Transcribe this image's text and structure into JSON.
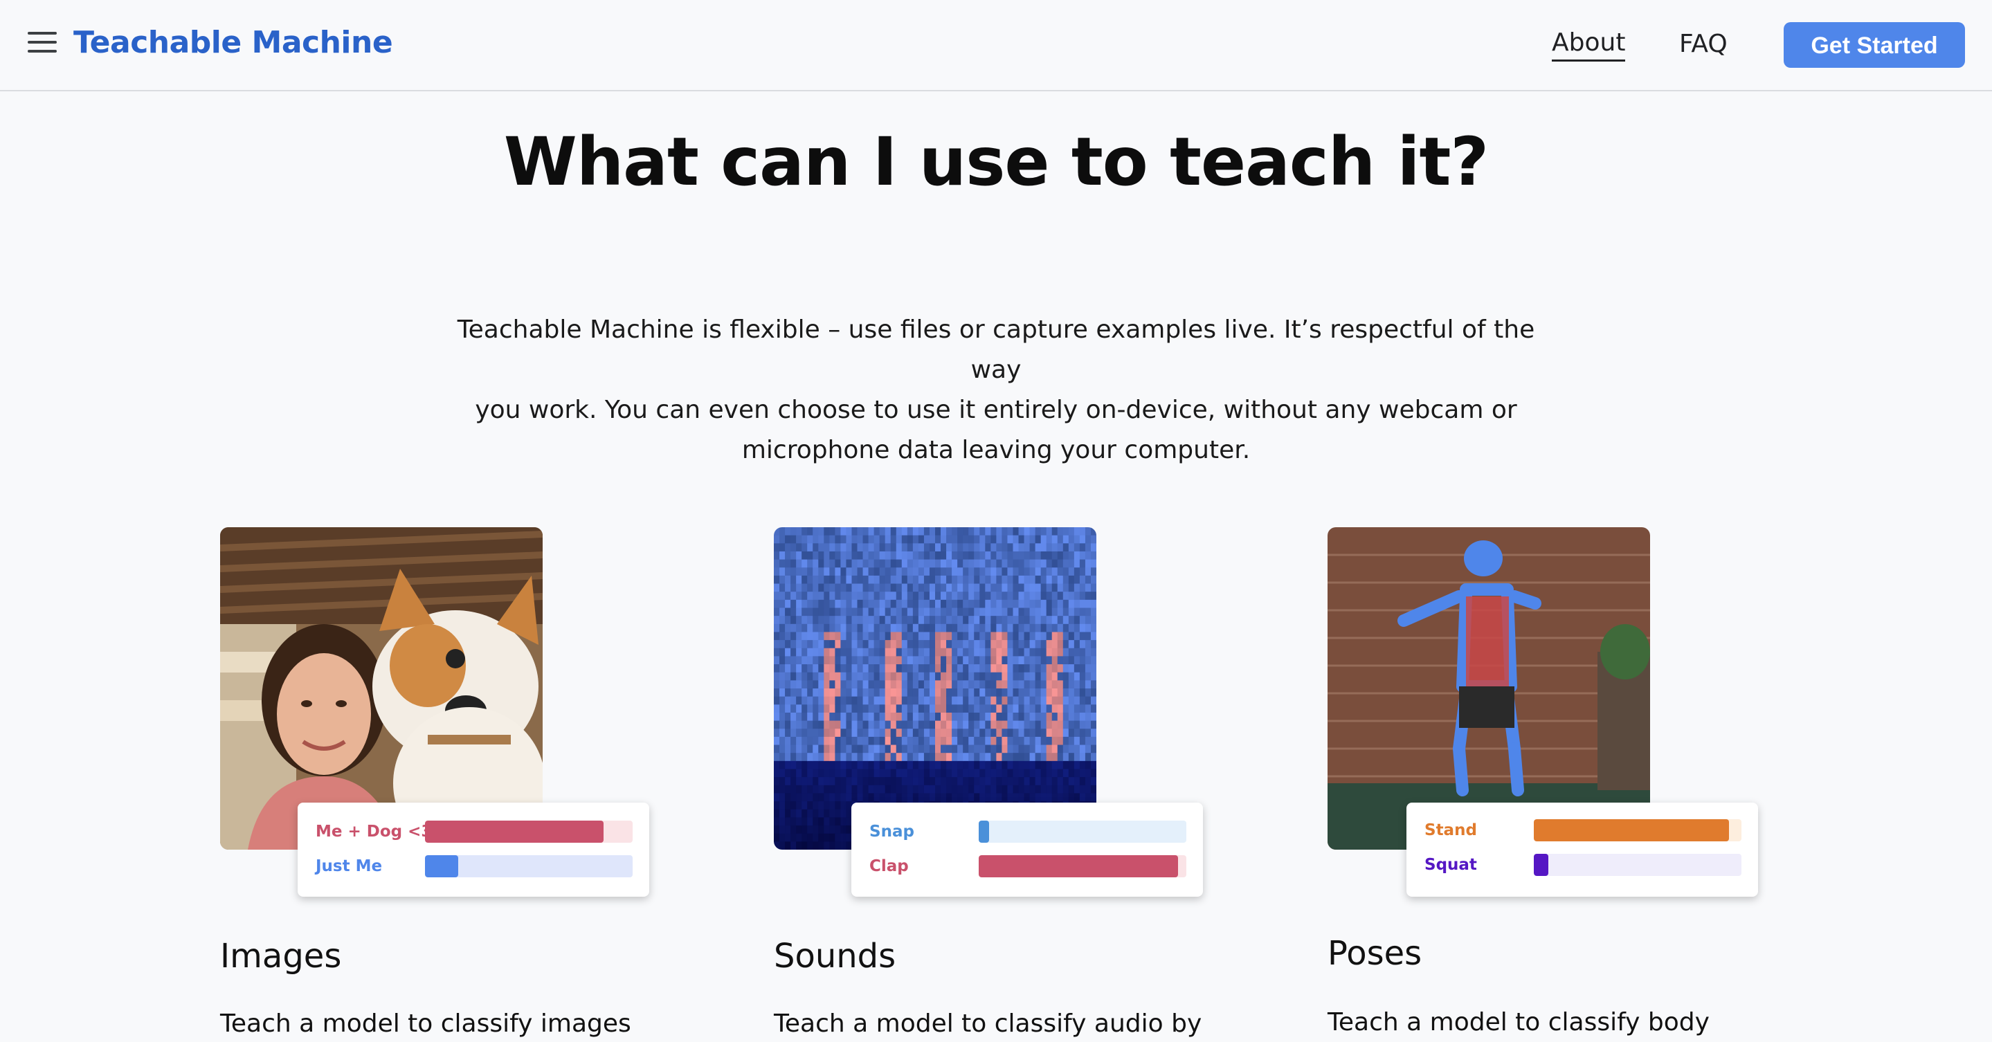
{
  "header": {
    "brand": "Teachable Machine",
    "nav": {
      "about": "About",
      "faq": "FAQ"
    },
    "cta": "Get Started"
  },
  "hero": {
    "title": "What can I use to teach it?",
    "intro_lines": [
      "Teachable Machine is flexible – use files or capture examples live. It’s respectful of the way",
      "you work. You can even choose to use it entirely on-device, without any webcam or",
      "microphone data leaving your computer."
    ]
  },
  "cards": [
    {
      "title": "Images",
      "description": "Teach a model to classify images",
      "image_icon": "selfie-with-plush-dog-photo",
      "classes": [
        {
          "label": "Me + Dog <3",
          "confidence": 0.86,
          "color": "#c9516b",
          "track": "#fae3e6"
        },
        {
          "label": "Just Me",
          "confidence": 0.16,
          "color": "#4f86ea",
          "track": "#dfe6fb"
        }
      ]
    },
    {
      "title": "Sounds",
      "description": "Teach a model to classify audio by",
      "image_icon": "spectrogram",
      "classes": [
        {
          "label": "Snap",
          "confidence": 0.05,
          "color": "#4a90d9",
          "track": "#e4f0fb"
        },
        {
          "label": "Clap",
          "confidence": 0.96,
          "color": "#c9516b",
          "track": "#fae3e6"
        }
      ]
    },
    {
      "title": "Poses",
      "description": "Teach a model to classify body",
      "image_icon": "pose-skeleton-photo",
      "classes": [
        {
          "label": "Stand",
          "confidence": 0.94,
          "color": "#e07b2d",
          "track": "#fdeede"
        },
        {
          "label": "Squat",
          "confidence": 0.07,
          "color": "#5517c4",
          "track": "#efedfb"
        }
      ]
    }
  ]
}
